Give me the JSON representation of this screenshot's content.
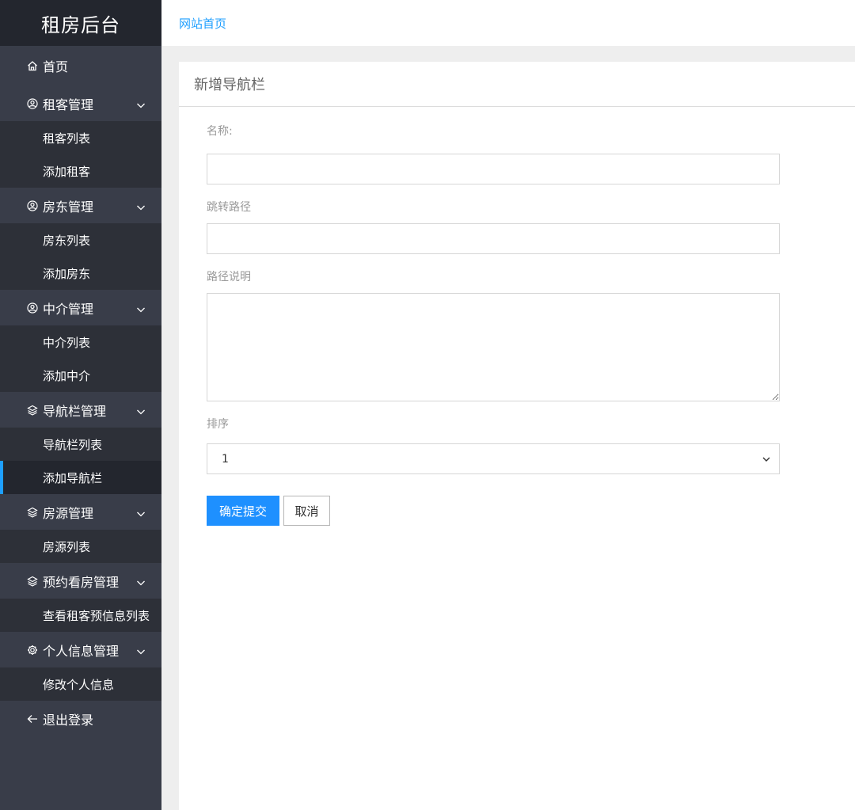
{
  "app": {
    "title": "租房后台"
  },
  "topbar": {
    "home_link": "网站首页"
  },
  "sidebar": {
    "home": {
      "icon": "home-icon",
      "label": "首页"
    },
    "groups": [
      {
        "icon": "user-circle-icon",
        "label": "租客管理",
        "items": [
          "租客列表",
          "添加租客"
        ]
      },
      {
        "icon": "user-circle-icon",
        "label": "房东管理",
        "items": [
          "房东列表",
          "添加房东"
        ]
      },
      {
        "icon": "user-circle-icon",
        "label": "中介管理",
        "items": [
          "中介列表",
          "添加中介"
        ]
      },
      {
        "icon": "layers-icon",
        "label": "导航栏管理",
        "items": [
          "导航栏列表",
          "添加导航栏"
        ]
      },
      {
        "icon": "layers-icon",
        "label": "房源管理",
        "items": [
          "房源列表"
        ]
      },
      {
        "icon": "layers-icon",
        "label": "预约看房管理",
        "items": [
          "查看租客预信息列表"
        ]
      },
      {
        "icon": "gear-icon",
        "label": "个人信息管理",
        "items": [
          "修改个人信息"
        ]
      }
    ],
    "active_item": "添加导航栏",
    "logout": {
      "icon": "arrow-left-icon",
      "label": "退出登录"
    },
    "colors": {
      "background": "#393d49",
      "brand_bg": "#23262e",
      "submenu_bg": "#2d3038",
      "active_accent": "#1e9fff"
    }
  },
  "card": {
    "title": "新增导航栏"
  },
  "form": {
    "name_label": "名称:",
    "name_value": "",
    "path_label": "跳转路径",
    "path_value": "",
    "desc_label": "路径说明",
    "desc_value": "",
    "order_label": "排序",
    "order_value": "1",
    "submit_label": "确定提交",
    "cancel_label": "取消"
  },
  "colors": {
    "primary": "#1e90ff",
    "link": "#1e9fff"
  }
}
